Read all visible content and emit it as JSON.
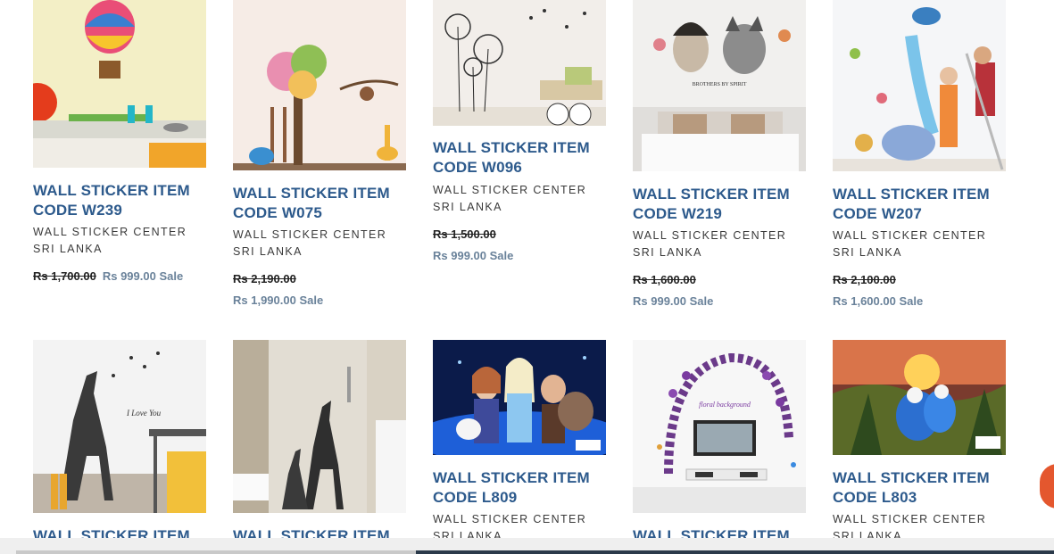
{
  "products": [
    {
      "title": "WALL STICKER ITEM CODE W239",
      "vendor": "WALL STICKER CENTER SRI LANKA",
      "old_price": "Rs 1,700.00",
      "price": "Rs 999.00",
      "sale": "Sale"
    },
    {
      "title": "WALL STICKER ITEM CODE W075",
      "vendor": "WALL STICKER CENTER SRI LANKA",
      "old_price": "Rs 2,190.00",
      "price": "Rs 1,990.00",
      "sale": "Sale"
    },
    {
      "title": "WALL STICKER ITEM CODE W096",
      "vendor": "WALL STICKER CENTER SRI LANKA",
      "old_price": "Rs 1,500.00",
      "price": "Rs 999.00",
      "sale": "Sale"
    },
    {
      "title": "WALL STICKER ITEM CODE W219",
      "vendor": "WALL STICKER CENTER SRI LANKA",
      "old_price": "Rs 1,600.00",
      "price": "Rs 999.00",
      "sale": "Sale"
    },
    {
      "title": "WALL STICKER ITEM CODE W207",
      "vendor": "WALL STICKER CENTER SRI LANKA",
      "old_price": "Rs 2,100.00",
      "price": "Rs 1,600.00",
      "sale": "Sale"
    },
    {
      "title": "WALL STICKER ITEM"
    },
    {
      "title": "WALL STICKER ITEM"
    },
    {
      "title": "WALL STICKER ITEM CODE L809",
      "vendor": "WALL STICKER CENTER SRI LANKA"
    },
    {
      "title": "WALL STICKER ITEM"
    },
    {
      "title": "WALL STICKER ITEM CODE L803",
      "vendor": "WALL STICKER CENTER SRI LANKA"
    }
  ],
  "image_texts": {
    "w219": "BROTHERS BY SPIRIT",
    "giraffe": "I Love You",
    "floral": "floral background"
  },
  "colors": {
    "title": "#2d5a8c",
    "sale_price": "#6a829a",
    "chat_button": "#e4572e"
  }
}
